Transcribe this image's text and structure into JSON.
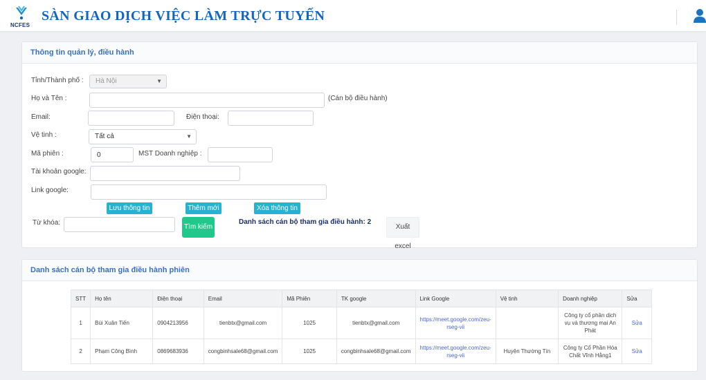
{
  "header": {
    "logo_text": "NCFES",
    "title": "SÀN GIAO DỊCH VIỆC LÀM TRỰC TUYẾN"
  },
  "form_card": {
    "title": "Thông tin quản lý, điều hành",
    "province_label": "Tỉnh/Thành phố :",
    "province_value": "Hà Nội",
    "fullname_label": "Họ và Tên :",
    "fullname_value": "",
    "fullname_note": "(Cán bộ điều hành)",
    "email_label": "Email:",
    "email_value": "",
    "phone_label": "Điện thoại:",
    "phone_value": "",
    "satellite_label": "Vệ tinh :",
    "satellite_value": "Tất cả",
    "session_label": "Mã phiên :",
    "session_value": "0",
    "tax_label": "MST Doanh nghiệp :",
    "tax_value": "",
    "google_account_label": "Tài khoản google:",
    "google_account_value": "",
    "google_link_label": "Link google:",
    "google_link_value": "",
    "save_button": "Lưu thông tin",
    "add_button": "Thêm mới",
    "delete_button": "Xóa thông tin",
    "keyword_label": "Từ khóa:",
    "keyword_value": "",
    "search_button": "Tìm kiếm",
    "count_text": "Danh sách cán bộ tham gia điều hành: 2",
    "export_button": "Xuất excel"
  },
  "list_card": {
    "title": "Danh sách cán bộ tham gia điều hành phiên",
    "columns": [
      "STT",
      "Họ tên",
      "Điện thoại",
      "Email",
      "Mã Phiên",
      "TK google",
      "Link Google",
      "Vệ tinh",
      "Doanh nghiệp",
      "Sửa"
    ],
    "rows": [
      {
        "stt": "1",
        "name": "Bùi Xuân Tiến",
        "phone": "0904213956",
        "email": "tienbtx@gmail.com",
        "session": "1025",
        "google_account": "tienbtx@gmail.com",
        "google_link": "https://meet.google.com/zeu-rseg-vii",
        "satellite": "",
        "company": "Công ty cổ phần dịch vụ và thương mại An Phát",
        "edit": "Sửa"
      },
      {
        "stt": "2",
        "name": "Phạm Công Bình",
        "phone": "0869683936",
        "email": "congbinhsale68@gmail.com",
        "session": "1025",
        "google_account": "congbinhsale68@gmail.com",
        "google_link": "https://meet.google.com/zeu-rseg-vii",
        "satellite": "Huyện Thường Tín",
        "company": "Công ty Cổ Phần Hóa Chất Vĩnh Hằng1",
        "edit": "Sửa"
      }
    ]
  }
}
